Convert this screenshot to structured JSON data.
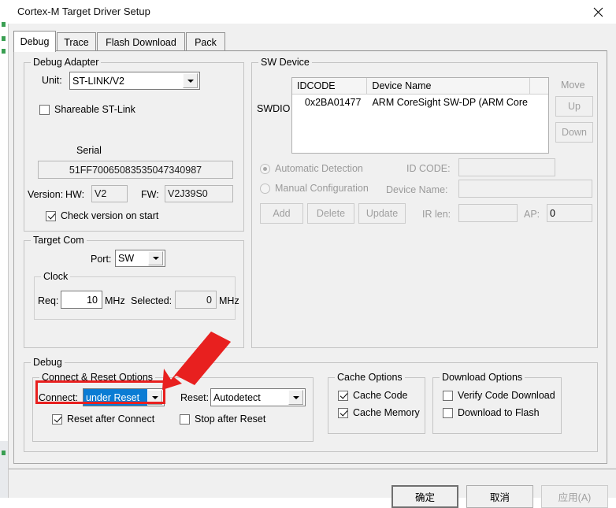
{
  "window": {
    "title": "Cortex-M Target Driver Setup",
    "close_icon": "close-icon"
  },
  "tabs": [
    {
      "label": "Debug",
      "active": true
    },
    {
      "label": "Trace",
      "active": false
    },
    {
      "label": "Flash Download",
      "active": false
    },
    {
      "label": "Pack",
      "active": false
    }
  ],
  "debug_adapter": {
    "legend": "Debug Adapter",
    "unit_label": "Unit:",
    "unit_value": "ST-LINK/V2",
    "shareable_label": "Shareable ST-Link",
    "shareable_checked": false,
    "serial_label": "Serial",
    "serial_value": "51FF70065083535047340987",
    "version_label": "Version:",
    "hw_label": "HW:",
    "hw_value": "V2",
    "fw_label": "FW:",
    "fw_value": "V2J39S0",
    "check_version_label": "Check version on start",
    "check_version_checked": true
  },
  "sw_device": {
    "legend": "SW Device",
    "port_label": "SWDIO",
    "columns": [
      "IDCODE",
      "Device Name",
      ""
    ],
    "rows": [
      {
        "idcode": "0x2BA01477",
        "device_name": "ARM CoreSight SW-DP (ARM Core",
        "extra": ""
      }
    ],
    "move_label": "Move",
    "up_label": "Up",
    "down_label": "Down",
    "automatic_detection_label": "Automatic Detection",
    "automatic_detection_selected": true,
    "manual_configuration_label": "Manual Configuration",
    "manual_configuration_selected": false,
    "id_code_label": "ID CODE:",
    "id_code_value": "",
    "device_name_label": "Device Name:",
    "device_name_value": "",
    "add_label": "Add",
    "delete_label": "Delete",
    "update_label": "Update",
    "ir_len_label": "IR len:",
    "ir_len_value": "",
    "ap_label": "AP:",
    "ap_value": "0"
  },
  "target_com": {
    "legend": "Target Com",
    "port_label": "Port:",
    "port_value": "SW",
    "clock_legend": "Clock",
    "req_label": "Req:",
    "req_value": "10",
    "req_unit": "MHz",
    "selected_label": "Selected:",
    "selected_value": "0",
    "selected_unit": "MHz"
  },
  "debug_group": {
    "legend": "Debug",
    "connect_reset": {
      "legend": "Connect & Reset Options",
      "connect_label": "Connect:",
      "connect_value": "under Reset",
      "reset_label": "Reset:",
      "reset_value": "Autodetect",
      "reset_after_connect_label": "Reset after Connect",
      "reset_after_connect_checked": true,
      "stop_after_reset_label": "Stop after Reset",
      "stop_after_reset_checked": false
    },
    "cache_options": {
      "legend": "Cache Options",
      "cache_code_label": "Cache Code",
      "cache_code_checked": true,
      "cache_memory_label": "Cache Memory",
      "cache_memory_checked": true
    },
    "download_options": {
      "legend": "Download Options",
      "verify_code_download_label": "Verify Code Download",
      "verify_code_download_checked": false,
      "download_to_flash_label": "Download to Flash",
      "download_to_flash_checked": false
    }
  },
  "dialog_buttons": {
    "ok_label": "确定",
    "cancel_label": "取消",
    "apply_label": "应用(A)",
    "apply_disabled": true
  },
  "annotation": {
    "highlight_color": "#e8201f",
    "arrow_color": "#e8201f",
    "target": "connect-combo"
  }
}
